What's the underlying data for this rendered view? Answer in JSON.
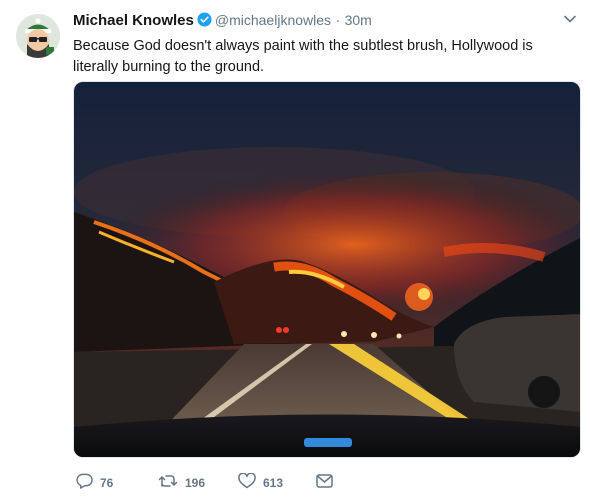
{
  "tweet": {
    "author_name": "Michael Knowles",
    "author_handle": "@michaeljknowles",
    "separator": "·",
    "timestamp": "30m",
    "text": "Because God doesn't always paint with the subtlest brush, Hollywood is literally burning to the ground.",
    "verified": true
  },
  "actions": {
    "reply_count": "76",
    "retweet_count": "196",
    "like_count": "613"
  },
  "icons": {
    "reply": "reply-icon",
    "retweet": "retweet-icon",
    "like": "heart-icon",
    "dm": "envelope-icon",
    "more": "chevron-down-icon",
    "verified": "verified-badge-icon"
  },
  "colors": {
    "verified_blue": "#1da1f2",
    "meta_gray": "#657786",
    "text_dark": "#14171a"
  }
}
